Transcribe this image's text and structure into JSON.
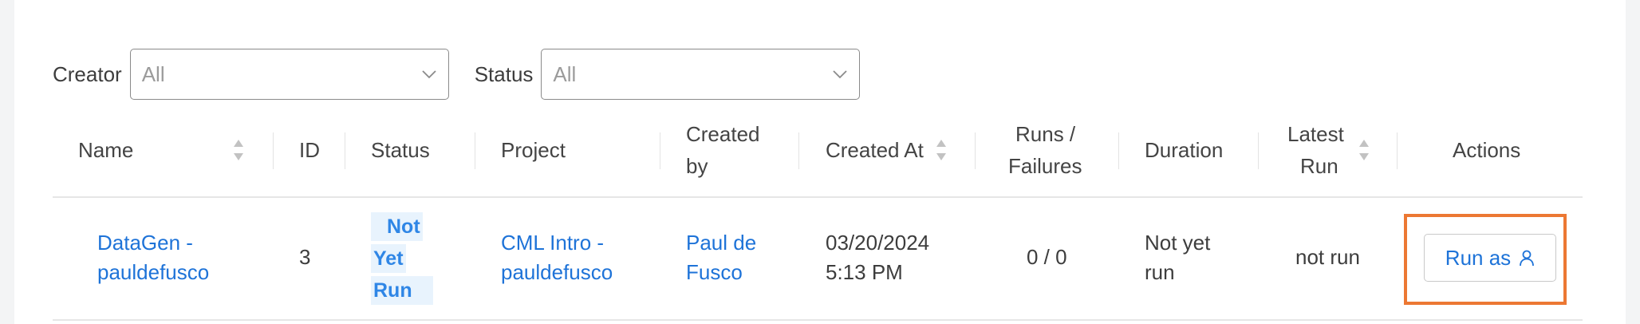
{
  "filters": {
    "creator_label": "Creator",
    "creator_value": "All",
    "status_label": "Status",
    "status_value": "All"
  },
  "table": {
    "headers": {
      "name": "Name",
      "id": "ID",
      "status": "Status",
      "project": "Project",
      "created_by_1": "Created",
      "created_by_2": "by",
      "created_at": "Created At",
      "runs_1": "Runs /",
      "runs_2": "Failures",
      "duration": "Duration",
      "latest_1": "Latest",
      "latest_2": "Run",
      "actions": "Actions"
    },
    "rows": [
      {
        "name_1": "DataGen -",
        "name_2": "pauldefusco",
        "id": "3",
        "status_1": "Not",
        "status_2": "Yet",
        "status_3": "Run",
        "project_1": "CML Intro -",
        "project_2": "pauldefusco",
        "created_by_1": "Paul de",
        "created_by_2": "Fusco",
        "created_at_1": "03/20/2024",
        "created_at_2": "5:13 PM",
        "runs": "0 / 0",
        "duration_1": "Not yet",
        "duration_2": "run",
        "latest_run": "not run",
        "action_label": "Run as"
      }
    ]
  },
  "icons": {
    "dropdown": "chevron-down-icon",
    "sort": "sort-icon",
    "user": "user-icon"
  },
  "colors": {
    "link": "#1e73d8",
    "status_pill_bg": "#e8f3fd",
    "highlight": "#ec7833"
  }
}
